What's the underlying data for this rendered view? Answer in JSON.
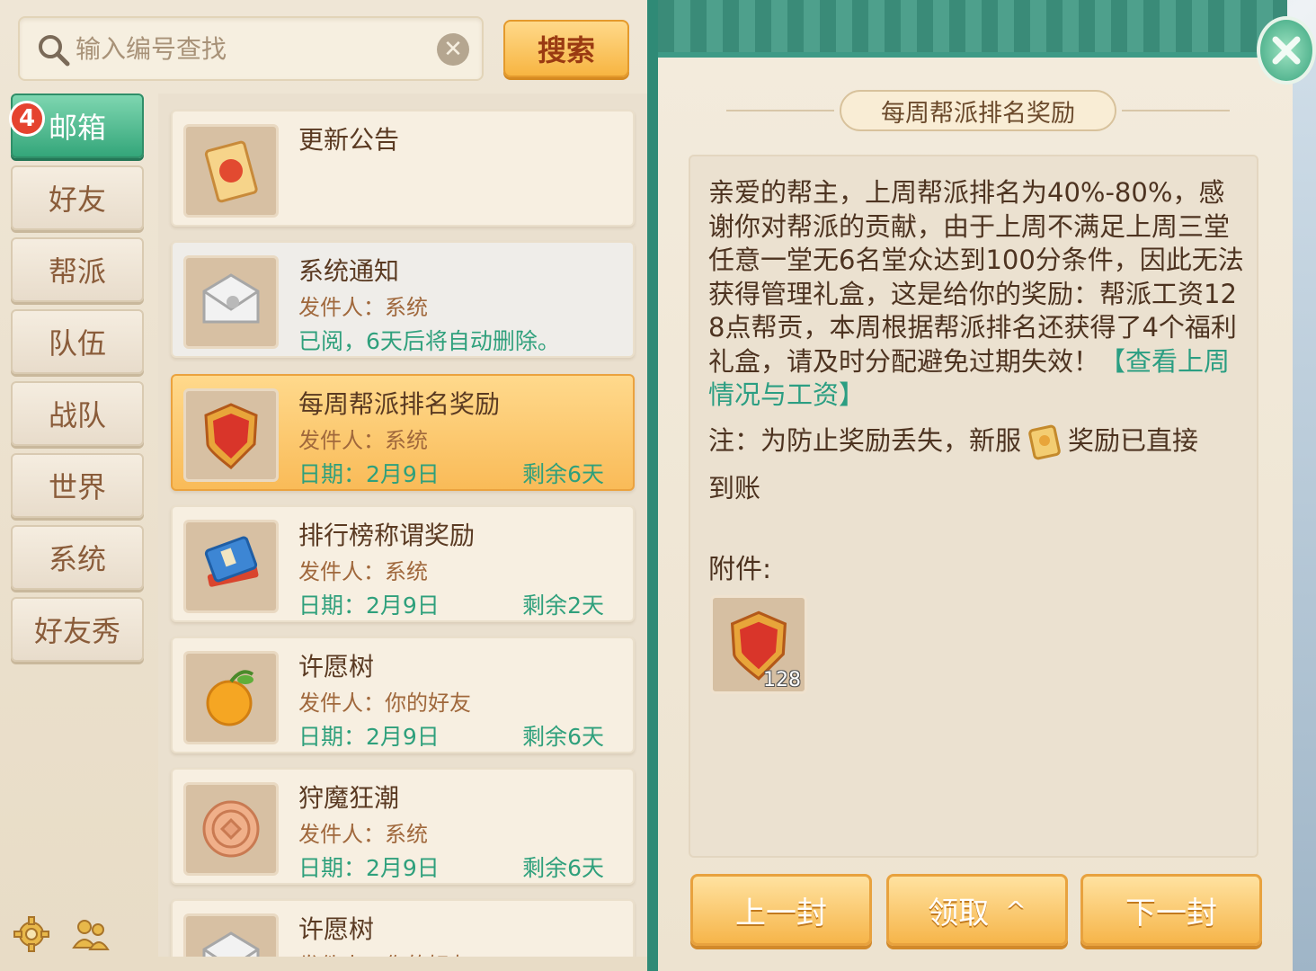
{
  "search": {
    "placeholder": "输入编号查找",
    "button_label": "搜索"
  },
  "tabs": [
    {
      "label": "邮箱",
      "active": true,
      "badge": "4"
    },
    {
      "label": "好友"
    },
    {
      "label": "帮派"
    },
    {
      "label": "队伍"
    },
    {
      "label": "战队"
    },
    {
      "label": "世界"
    },
    {
      "label": "系统"
    },
    {
      "label": "好友秀"
    }
  ],
  "mails": [
    {
      "title": "更新公告",
      "icon": "announcement-scroll-icon"
    },
    {
      "title": "系统通知",
      "sender": "发件人：系统",
      "note": "已阅，6天后将自动删除。",
      "icon": "envelope-icon",
      "read": true
    },
    {
      "title": "每周帮派排名奖励",
      "sender": "发件人：系统",
      "date": "日期：2月9日",
      "remain": "剩余6天",
      "icon": "contribution-badge-icon",
      "selected": true
    },
    {
      "title": "排行榜称谓奖励",
      "sender": "发件人：系统",
      "date": "日期：2月9日",
      "remain": "剩余2天",
      "icon": "book-stack-icon"
    },
    {
      "title": "许愿树",
      "sender": "发件人：你的好友",
      "date": "日期：2月9日",
      "remain": "剩余6天",
      "icon": "wish-fruit-icon"
    },
    {
      "title": "狩魔狂潮",
      "sender": "发件人：系统",
      "date": "日期：2月9日",
      "remain": "剩余6天",
      "icon": "coin-icon"
    },
    {
      "title": "许愿树",
      "sender": "发件人：你的好友",
      "icon": "envelope-icon"
    }
  ],
  "detail": {
    "title": "每周帮派排名奖励",
    "body": "亲爱的帮主，上周帮派排名为40%-80%，感谢你对帮派的贡献，由于上周不满足上周三堂任意一堂无6名堂众达到100分条件，因此无法获得管理礼盒，这是给你的奖励：帮派工资128点帮贡，本周根据帮派排名还获得了4个福利礼盒，请及时分配避免过期失效！",
    "link": "【查看上周情况与工资】",
    "note_before": "注：为防止奖励丢失，新服",
    "note_after": "奖励已直接",
    "note_tail": "到账",
    "attach_label": "附件:",
    "attachment": {
      "icon": "contribution-badge-icon",
      "qty": "128"
    }
  },
  "buttons": {
    "prev": "上一封",
    "claim": "领取",
    "next": "下一封"
  },
  "colors": {
    "accent_green": "#34a67a",
    "selected_orange": "#f9bb58",
    "link_green": "#2b9e82"
  }
}
